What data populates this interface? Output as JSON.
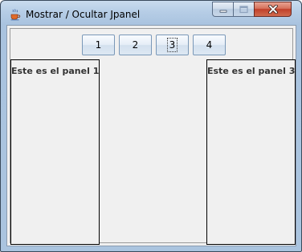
{
  "window": {
    "title": "Mostrar / Ocultar Jpanel",
    "app_icon": "java-coffee-cup-icon",
    "controls": {
      "minimize_icon": "minimize-icon",
      "maximize_icon": "maximize-icon",
      "close_icon": "close-icon"
    }
  },
  "toolbar": {
    "buttons": [
      {
        "label": "1"
      },
      {
        "label": "2"
      },
      {
        "label": "3"
      },
      {
        "label": "4"
      }
    ],
    "focused_button": "3"
  },
  "panels": {
    "left_label": "Este es el panel 1",
    "right_label": "Este es el panel 3"
  },
  "colors": {
    "title_bar": "#aac4df",
    "close_button": "#c0402a",
    "client_background": "#f0f0f0",
    "panel_border": "#000000"
  }
}
